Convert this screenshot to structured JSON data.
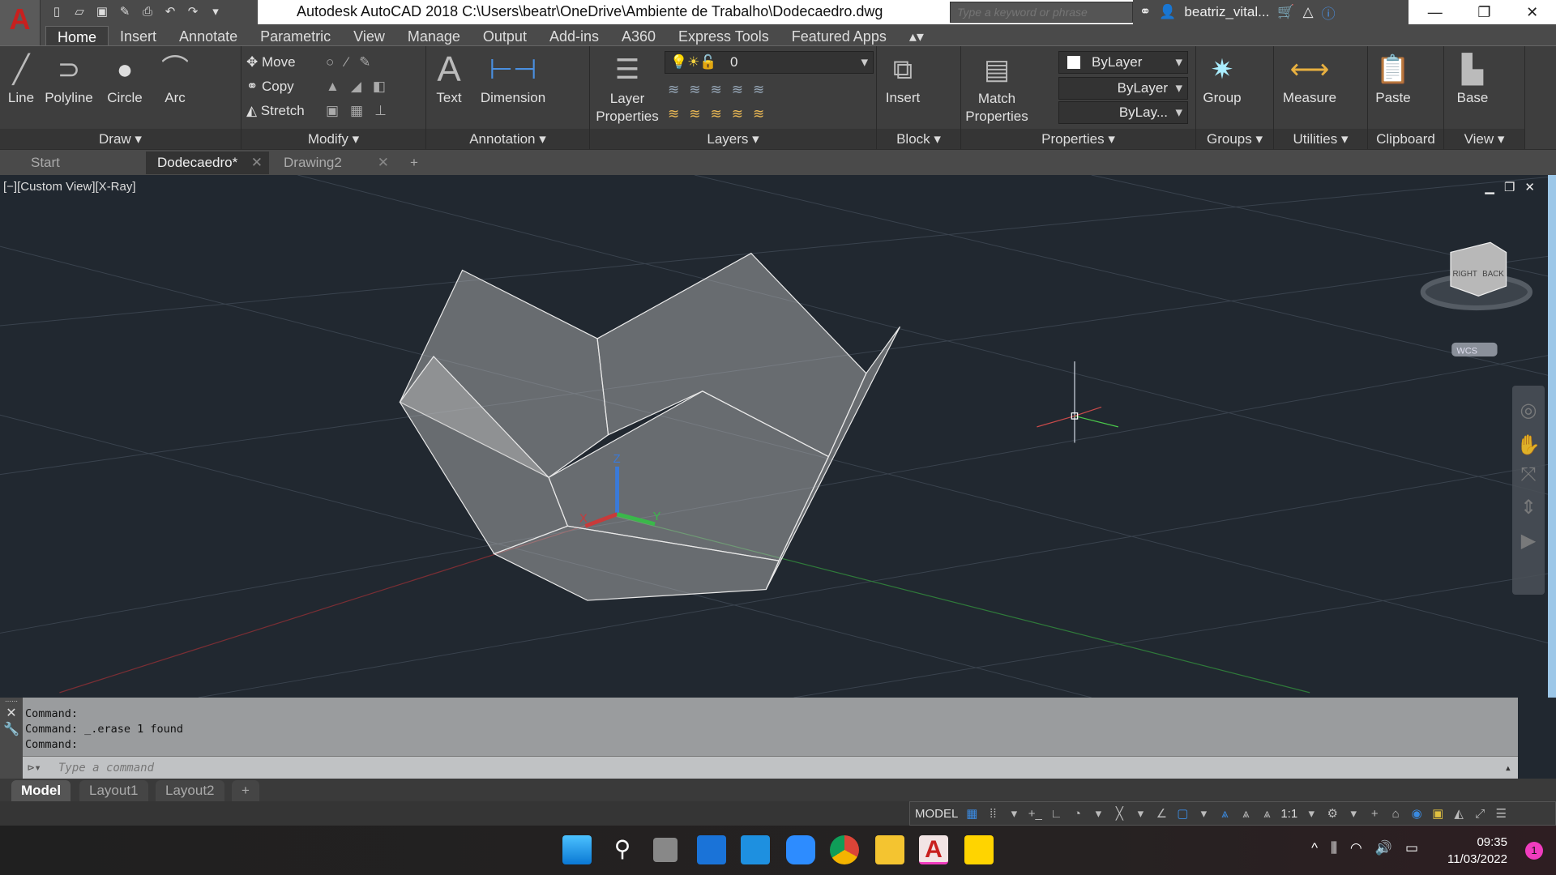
{
  "app": {
    "logo": "A",
    "title": "Autodesk AutoCAD 2018    C:\\Users\\beatr\\OneDrive\\Ambiente de Trabalho\\Dodecaedro.dwg"
  },
  "search": {
    "placeholder": "Type a keyword or phrase"
  },
  "user": {
    "name": "beatriz_vital..."
  },
  "ribbon_tabs": [
    "Home",
    "Insert",
    "Annotate",
    "Parametric",
    "View",
    "Manage",
    "Output",
    "Add-ins",
    "A360",
    "Express Tools",
    "Featured Apps"
  ],
  "panels": {
    "draw": {
      "label": "Draw ▾",
      "line": "Line",
      "polyline": "Polyline",
      "circle": "Circle",
      "arc": "Arc"
    },
    "modify": {
      "label": "Modify ▾",
      "move": "Move",
      "copy": "Copy",
      "stretch": "Stretch"
    },
    "annotation": {
      "label": "Annotation ▾",
      "text": "Text",
      "dimension": "Dimension"
    },
    "layers": {
      "label": "Layers ▾",
      "layer_properties": "Layer Properties",
      "current_layer": "0"
    },
    "block": {
      "label": "Block ▾",
      "insert": "Insert"
    },
    "properties": {
      "label": "Properties ▾",
      "match": "Match Properties",
      "color": "ByLayer",
      "linetype": "ByLayer",
      "lineweight": "ByLay..."
    },
    "groups": {
      "label": "Groups ▾",
      "group": "Group"
    },
    "utilities": {
      "label": "Utilities ▾",
      "measure": "Measure"
    },
    "clipboard": {
      "label": "Clipboard",
      "paste": "Paste"
    },
    "view": {
      "label": "View ▾",
      "base": "Base"
    }
  },
  "file_tabs": [
    {
      "label": "Start"
    },
    {
      "label": "Dodecaedro*",
      "active": true
    },
    {
      "label": "Drawing2"
    }
  ],
  "viewport": {
    "label": "[−][Custom View][X-Ray]",
    "viewcube": {
      "left": "RIGHT",
      "right": "BACK"
    },
    "ucs": "WCS",
    "axis_z": "Z",
    "axis_x": "X",
    "axis_y": "Y"
  },
  "command": {
    "history": [
      "Command:",
      "Command: _.erase 1 found",
      "Command:"
    ],
    "placeholder": "Type a command"
  },
  "layout_tabs": [
    {
      "label": "Model",
      "active": true
    },
    {
      "label": "Layout1"
    },
    {
      "label": "Layout2"
    }
  ],
  "status": {
    "mode": "MODEL",
    "scale": "1:1"
  },
  "taskbar": {
    "time": "09:35",
    "date": "11/03/2022",
    "notifications": "1"
  },
  "colors": {
    "accent_red": "#c8201e",
    "viewport_bg": "#212830",
    "ribbon_bg": "#3e3e3e"
  }
}
